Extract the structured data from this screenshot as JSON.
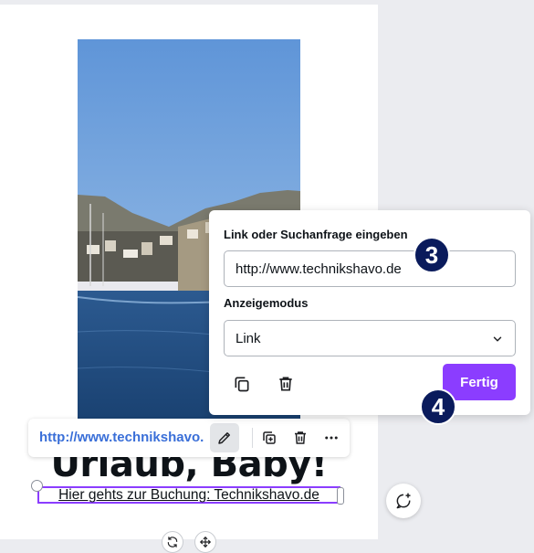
{
  "canvas": {
    "headline": "Urlaub, Baby!",
    "subline": "Hier gehts zur Buchung: Technikshavo.de"
  },
  "toolbar": {
    "link_text": "http://www.technikshavo.",
    "edit_icon": "pencil-icon",
    "duplicate_icon": "duplicate-icon",
    "delete_icon": "trash-icon",
    "more_icon": "more-icon"
  },
  "link_panel": {
    "input_label": "Link oder Suchanfrage eingeben",
    "input_value": "http://www.technikshavo.de",
    "mode_label": "Anzeigemodus",
    "mode_value": "Link",
    "done_label": "Fertig"
  },
  "badges": {
    "step_3": "3",
    "step_4": "4"
  },
  "colors": {
    "accent": "#8b3dff",
    "badge": "#0a1b5c",
    "link": "#3a6fd8",
    "canvas_bg": "#ebecf0"
  }
}
